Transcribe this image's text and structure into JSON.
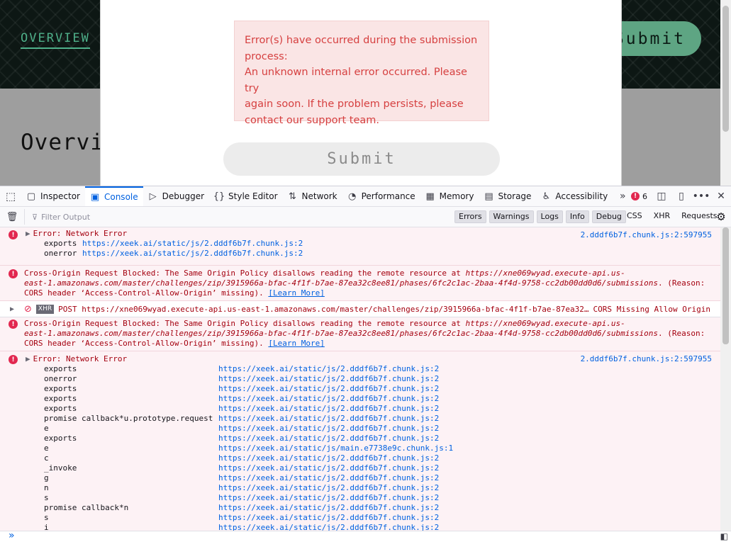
{
  "page": {
    "nav_overview": "OVERVIEW",
    "top_submit": "Submit",
    "heading": "Overvi",
    "modal_submit": "Submit",
    "error_lines": [
      "Error(s) have occurred during the submission",
      "process:",
      "An unknown internal error occurred. Please try",
      "again soon. If the problem persists, please",
      "contact our support team."
    ]
  },
  "devtools": {
    "tabs": [
      {
        "label": "Inspector",
        "icon": "inspector-icon"
      },
      {
        "label": "Console",
        "icon": "console-icon"
      },
      {
        "label": "Debugger",
        "icon": "debugger-icon"
      },
      {
        "label": "Style Editor",
        "icon": "style-editor-icon"
      },
      {
        "label": "Network",
        "icon": "network-icon"
      },
      {
        "label": "Performance",
        "icon": "performance-icon"
      },
      {
        "label": "Memory",
        "icon": "memory-icon"
      },
      {
        "label": "Storage",
        "icon": "storage-icon"
      },
      {
        "label": "Accessibility",
        "icon": "accessibility-icon"
      }
    ],
    "error_count": "6",
    "filter_placeholder": "Filter Output",
    "levels": [
      "Errors",
      "Warnings",
      "Logs",
      "Info",
      "Debug"
    ],
    "kinds": [
      "CSS",
      "XHR",
      "Requests"
    ],
    "messages": {
      "m1_title": "Error: Network Error",
      "m1_loc": "2.dddf6b7f.chunk.js:2:597955",
      "m1_s1_fn": "exports",
      "m1_s1_src": "https://xeek.ai/static/js/2.dddf6b7f.chunk.js:2",
      "m1_s2_fn": "onerror",
      "m1_s2_src": "https://xeek.ai/static/js/2.dddf6b7f.chunk.js:2",
      "cors_1_a": "Cross-Origin Request Blocked: The Same Origin Policy disallows reading the remote resource at ",
      "cors_1_url_a": "https://xne069wyad.execute-api.us-",
      "cors_1_url_b": "east-1.amazonaws.com/master/challenges/zip/3915966a-bfac-4f1f-b7ae-87ea32c8ee81/phases/6fc2c1ac-2baa-4f4d-9758-cc2db00dd0d6/submissions",
      "cors_1_reason": ". (Reason:",
      "cors_1_c": "CORS header ‘Access-Control-Allow-Origin’ missing). ",
      "learn_more": "[Learn More]",
      "xhr_badge": "XHR",
      "xhr_text": "POST https://xne069wyad.execute-api.us-east-1.amazonaws.com/master/challenges/zip/3915966a-bfac-4f1f-b7ae-87ea32…",
      "xhr_status": "CORS Missing Allow Origin",
      "m4_title": "Error: Network Error",
      "m4_loc": "2.dddf6b7f.chunk.js:2:597955",
      "stack": [
        {
          "fn": "exports",
          "src": "https://xeek.ai/static/js/2.dddf6b7f.chunk.js:2"
        },
        {
          "fn": "onerror",
          "src": "https://xeek.ai/static/js/2.dddf6b7f.chunk.js:2"
        },
        {
          "fn": "exports",
          "src": "https://xeek.ai/static/js/2.dddf6b7f.chunk.js:2"
        },
        {
          "fn": "exports",
          "src": "https://xeek.ai/static/js/2.dddf6b7f.chunk.js:2"
        },
        {
          "fn": "exports",
          "src": "https://xeek.ai/static/js/2.dddf6b7f.chunk.js:2"
        },
        {
          "fn": "promise callback*u.prototype.request",
          "src": "https://xeek.ai/static/js/2.dddf6b7f.chunk.js:2"
        },
        {
          "fn": "e",
          "src": "https://xeek.ai/static/js/2.dddf6b7f.chunk.js:2"
        },
        {
          "fn": "exports",
          "src": "https://xeek.ai/static/js/2.dddf6b7f.chunk.js:2"
        },
        {
          "fn": "e",
          "src": "https://xeek.ai/static/js/main.e7738e9c.chunk.js:1"
        },
        {
          "fn": "c",
          "src": "https://xeek.ai/static/js/2.dddf6b7f.chunk.js:2"
        },
        {
          "fn": "_invoke",
          "src": "https://xeek.ai/static/js/2.dddf6b7f.chunk.js:2"
        },
        {
          "fn": "g",
          "src": "https://xeek.ai/static/js/2.dddf6b7f.chunk.js:2"
        },
        {
          "fn": "n",
          "src": "https://xeek.ai/static/js/2.dddf6b7f.chunk.js:2"
        },
        {
          "fn": "s",
          "src": "https://xeek.ai/static/js/2.dddf6b7f.chunk.js:2"
        },
        {
          "fn": "promise callback*n",
          "src": "https://xeek.ai/static/js/2.dddf6b7f.chunk.js:2"
        },
        {
          "fn": "s",
          "src": "https://xeek.ai/static/js/2.dddf6b7f.chunk.js:2"
        },
        {
          "fn": "i",
          "src": "https://xeek.ai/static/js/2.dddf6b7f.chunk.js:2"
        }
      ]
    }
  },
  "colors": {
    "accent": "#0061e0",
    "error": "#a4000f",
    "error_bg": "#fdf2f5",
    "brand_green": "#5ea583"
  }
}
